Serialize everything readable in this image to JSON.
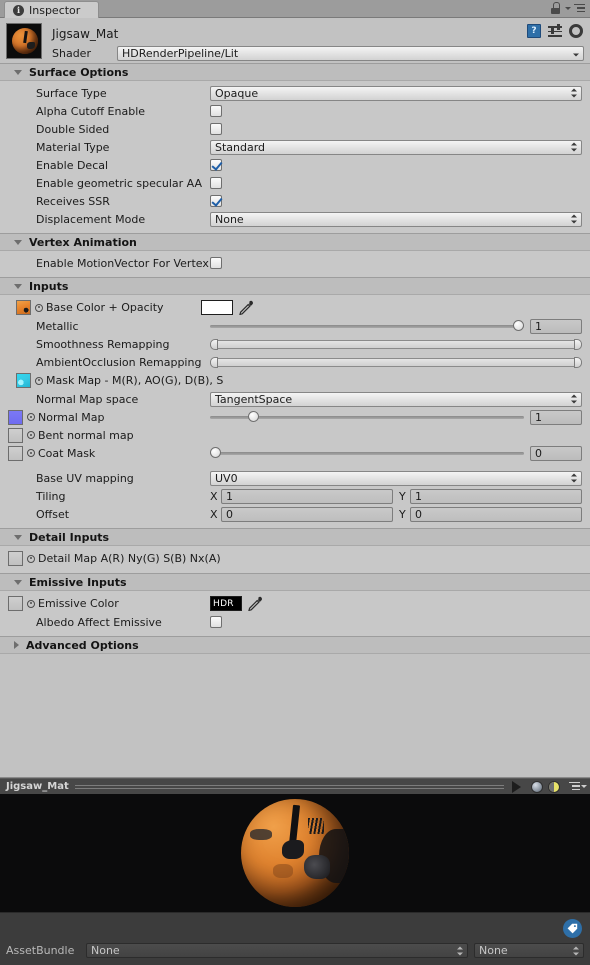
{
  "window": {
    "tab_label": "Inspector",
    "tab_icon": "info-icon",
    "lock_icon": "lock-icon",
    "tab_menu_icon": "hamburger-menu-icon"
  },
  "material": {
    "name": "Jigsaw_Mat",
    "thumbnail": "material-sphere-preview",
    "shader_label": "Shader",
    "shader_value": "HDRenderPipeline/Lit",
    "header_icons": [
      {
        "name": "help-icon",
        "glyph": "?"
      },
      {
        "name": "preset-icon",
        "glyph": ""
      },
      {
        "name": "gear-icon",
        "glyph": ""
      }
    ]
  },
  "surface_options": {
    "title": "Surface Options",
    "expanded": true,
    "rows": [
      {
        "label": "Surface Type",
        "type": "dropdown",
        "value": "Opaque"
      },
      {
        "label": "Alpha Cutoff Enable",
        "type": "checkbox",
        "checked": false
      },
      {
        "label": "Double Sided",
        "type": "checkbox",
        "checked": false
      },
      {
        "label": "Material Type",
        "type": "dropdown",
        "value": "Standard"
      },
      {
        "label": "Enable Decal",
        "type": "checkbox",
        "checked": true
      },
      {
        "label": "Enable geometric specular AA",
        "type": "checkbox",
        "checked": false
      },
      {
        "label": "Receives SSR",
        "type": "checkbox",
        "checked": true
      },
      {
        "label": "Displacement Mode",
        "type": "dropdown",
        "value": "None"
      }
    ]
  },
  "vertex_animation": {
    "title": "Vertex Animation",
    "expanded": true,
    "rows": [
      {
        "label": "Enable MotionVector For Vertex Anir",
        "type": "checkbox",
        "checked": false
      }
    ]
  },
  "inputs": {
    "title": "Inputs",
    "expanded": true,
    "base_color": {
      "label": "Base Color + Opacity",
      "texture_slot": "basecolor-texture-thumbnail",
      "color": "#ffffff"
    },
    "metallic": {
      "label": "Metallic",
      "value": "1",
      "slider_pct": 100
    },
    "smoothness_remap": {
      "label": "Smoothness Remapping",
      "min_pct": 0,
      "max_pct": 100
    },
    "ao_remap": {
      "label": "AmbientOcclusion Remapping",
      "min_pct": 0,
      "max_pct": 100
    },
    "mask_map": {
      "label": "Mask Map - M(R), AO(G), D(B), S",
      "texture_slot": "maskmap-texture-thumbnail"
    },
    "normal_map_space": {
      "label": "Normal Map space",
      "value": "TangentSpace"
    },
    "normal_map": {
      "label": "Normal Map",
      "texture_slot": "normalmap-texture-thumbnail",
      "value": "1",
      "slider_pct": 12
    },
    "bent_normal_map": {
      "label": "Bent normal map",
      "texture_slot": "empty-texture-slot"
    },
    "coat_mask": {
      "label": "Coat Mask",
      "texture_slot": "empty-texture-slot",
      "value": "0",
      "slider_pct": 0
    },
    "base_uv_mapping": {
      "label": "Base UV mapping",
      "value": "UV0"
    },
    "tiling": {
      "label": "Tiling",
      "x_axis": "X",
      "x": "1",
      "y_axis": "Y",
      "y": "1"
    },
    "offset": {
      "label": "Offset",
      "x_axis": "X",
      "x": "0",
      "y_axis": "Y",
      "y": "0"
    }
  },
  "detail_inputs": {
    "title": "Detail Inputs",
    "expanded": true,
    "detail_map": {
      "label": "Detail Map A(R) Ny(G) S(B) Nx(A)",
      "texture_slot": "empty-texture-slot"
    }
  },
  "emissive_inputs": {
    "title": "Emissive Inputs",
    "expanded": true,
    "emissive_color": {
      "label": "Emissive Color",
      "texture_slot": "empty-texture-slot",
      "swatch_label": "HDR",
      "swatch_color": "#000000"
    },
    "albedo_affect_emissive": {
      "label": "Albedo Affect Emissive",
      "checked": false
    }
  },
  "advanced_options": {
    "title": "Advanced Options",
    "expanded": false
  },
  "preview": {
    "title": "Jigsaw_Mat",
    "play_icon": "play-icon",
    "mesh_icon": "preview-sphere-icon",
    "lighting_icon": "preview-lighting-icon",
    "menu_icon": "preview-menu-icon"
  },
  "footer": {
    "tag_icon": "asset-label-tag-icon",
    "assetbundle_label": "AssetBundle",
    "assetbundle_value": "None",
    "assetbundle_variant_value": "None"
  },
  "colors": {
    "panel_bg": "#c2c2c2",
    "section_bg": "#bdbdbd",
    "accent_blue": "#2e6fa8",
    "checkbox_check": "#1f5fa8",
    "preview_bg": "#0b0b0c",
    "footer_bg": "#3c3c3c"
  }
}
